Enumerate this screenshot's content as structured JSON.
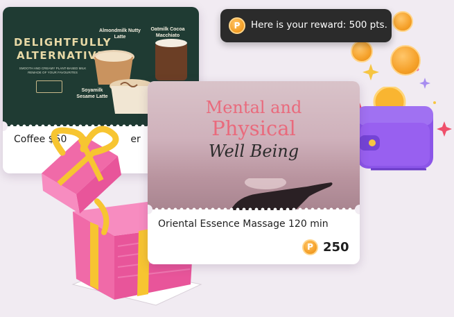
{
  "toast": {
    "message": "Here is your reward: 500 pts.",
    "coin_glyph": "P"
  },
  "coffee_card": {
    "headline_line1": "DELIGHTFULLY",
    "headline_line2": "ALTERNATIVE",
    "subline": "SMOOTH AND CREAMY PLANT-BASED MILK REMADE OF YOUR FAVOURITES",
    "drink1": "Almondmilk Nutty Latte",
    "drink2": "Oatmilk Cocoa Macchiato",
    "drink3": "Soyamilk Sesame Latte",
    "title": "Coffee $50",
    "title_tail": "er"
  },
  "massage_card": {
    "heading_line1": "Mental and",
    "heading_line2": "Physical",
    "heading_script": "Well Being",
    "title": "Oriental Essence Massage 120 min",
    "price": "250",
    "coin_glyph": "P"
  },
  "colors": {
    "accent_orange": "#f5a12a",
    "heading_pink": "#e96a7c",
    "wallet_purple": "#8b55e8",
    "gift_pink": "#f06aa8",
    "gift_ribbon": "#f7c531"
  }
}
